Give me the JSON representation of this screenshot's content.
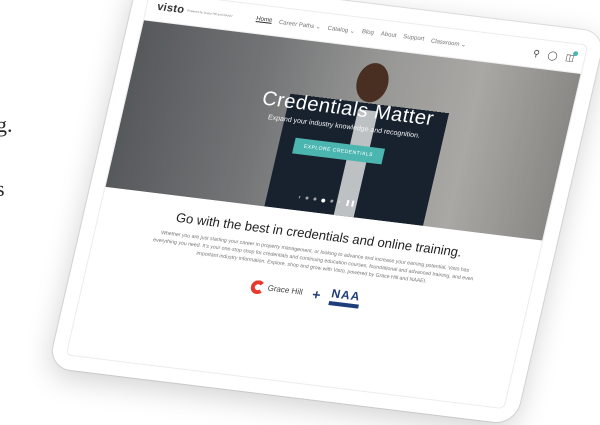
{
  "background_text": {
    "line1": "g.",
    "line2": "s"
  },
  "nav": {
    "logo": "visto",
    "logo_tagline": "Powered by Grace Hill and NAAEI",
    "links": [
      {
        "label": "Home",
        "active": true
      },
      {
        "label": "Career Paths ⌄",
        "active": false
      },
      {
        "label": "Catalog ⌄",
        "active": false
      },
      {
        "label": "Blog",
        "active": false
      },
      {
        "label": "About",
        "active": false
      },
      {
        "label": "Support",
        "active": false
      },
      {
        "label": "Classroom ⌄",
        "active": false
      }
    ],
    "icons": [
      "search-icon",
      "user-icon",
      "cart-icon"
    ]
  },
  "hero": {
    "title": "Credentials Matter",
    "subtitle": "Expand your industry knowledge and recognition.",
    "button": "EXPLORE CREDENTIALS"
  },
  "content": {
    "headline": "Go with the best in credentials and online training.",
    "paragraph": "Whether you are just starting your career in property management, or looking to advance and increase your earning potential, Visto has everything you need. It's your one-stop shop for credentials and continuing education courses, foundational and advanced training, and even important industry information. Explore, shop and grow with Visto, powered by Grace Hill and NAAEI."
  },
  "partners": {
    "gracehill": "Grace Hill",
    "plus": "+",
    "naa": "NAA",
    "naa_caption": "Education Institute"
  },
  "colors": {
    "accent": "#4bb6b0",
    "naa_blue": "#1e3d7a",
    "gracehill_red": "#e8392f"
  }
}
